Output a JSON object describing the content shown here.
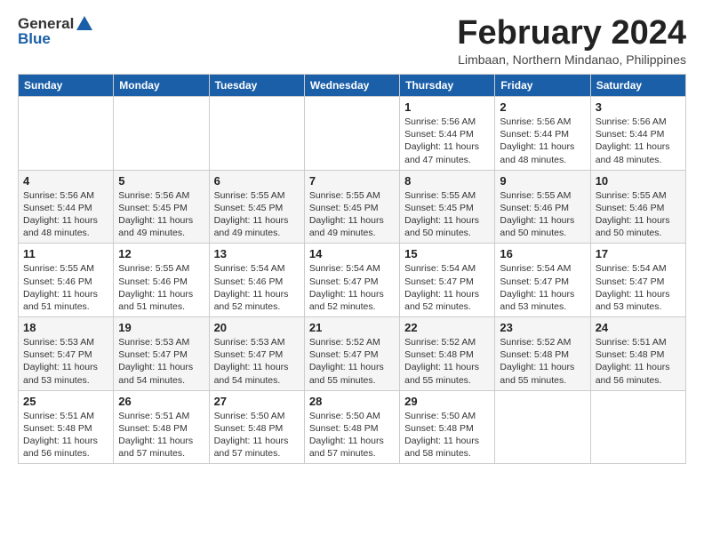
{
  "logo": {
    "text_general": "General",
    "text_blue": "Blue"
  },
  "title": "February 2024",
  "location": "Limbaan, Northern Mindanao, Philippines",
  "days_of_week": [
    "Sunday",
    "Monday",
    "Tuesday",
    "Wednesday",
    "Thursday",
    "Friday",
    "Saturday"
  ],
  "weeks": [
    [
      {
        "day": "",
        "info": ""
      },
      {
        "day": "",
        "info": ""
      },
      {
        "day": "",
        "info": ""
      },
      {
        "day": "",
        "info": ""
      },
      {
        "day": "1",
        "sunrise": "5:56 AM",
        "sunset": "5:44 PM",
        "daylight": "11 hours and 47 minutes."
      },
      {
        "day": "2",
        "sunrise": "5:56 AM",
        "sunset": "5:44 PM",
        "daylight": "11 hours and 48 minutes."
      },
      {
        "day": "3",
        "sunrise": "5:56 AM",
        "sunset": "5:44 PM",
        "daylight": "11 hours and 48 minutes."
      }
    ],
    [
      {
        "day": "4",
        "sunrise": "5:56 AM",
        "sunset": "5:44 PM",
        "daylight": "11 hours and 48 minutes."
      },
      {
        "day": "5",
        "sunrise": "5:56 AM",
        "sunset": "5:45 PM",
        "daylight": "11 hours and 49 minutes."
      },
      {
        "day": "6",
        "sunrise": "5:55 AM",
        "sunset": "5:45 PM",
        "daylight": "11 hours and 49 minutes."
      },
      {
        "day": "7",
        "sunrise": "5:55 AM",
        "sunset": "5:45 PM",
        "daylight": "11 hours and 49 minutes."
      },
      {
        "day": "8",
        "sunrise": "5:55 AM",
        "sunset": "5:45 PM",
        "daylight": "11 hours and 50 minutes."
      },
      {
        "day": "9",
        "sunrise": "5:55 AM",
        "sunset": "5:46 PM",
        "daylight": "11 hours and 50 minutes."
      },
      {
        "day": "10",
        "sunrise": "5:55 AM",
        "sunset": "5:46 PM",
        "daylight": "11 hours and 50 minutes."
      }
    ],
    [
      {
        "day": "11",
        "sunrise": "5:55 AM",
        "sunset": "5:46 PM",
        "daylight": "11 hours and 51 minutes."
      },
      {
        "day": "12",
        "sunrise": "5:55 AM",
        "sunset": "5:46 PM",
        "daylight": "11 hours and 51 minutes."
      },
      {
        "day": "13",
        "sunrise": "5:54 AM",
        "sunset": "5:46 PM",
        "daylight": "11 hours and 52 minutes."
      },
      {
        "day": "14",
        "sunrise": "5:54 AM",
        "sunset": "5:47 PM",
        "daylight": "11 hours and 52 minutes."
      },
      {
        "day": "15",
        "sunrise": "5:54 AM",
        "sunset": "5:47 PM",
        "daylight": "11 hours and 52 minutes."
      },
      {
        "day": "16",
        "sunrise": "5:54 AM",
        "sunset": "5:47 PM",
        "daylight": "11 hours and 53 minutes."
      },
      {
        "day": "17",
        "sunrise": "5:54 AM",
        "sunset": "5:47 PM",
        "daylight": "11 hours and 53 minutes."
      }
    ],
    [
      {
        "day": "18",
        "sunrise": "5:53 AM",
        "sunset": "5:47 PM",
        "daylight": "11 hours and 53 minutes."
      },
      {
        "day": "19",
        "sunrise": "5:53 AM",
        "sunset": "5:47 PM",
        "daylight": "11 hours and 54 minutes."
      },
      {
        "day": "20",
        "sunrise": "5:53 AM",
        "sunset": "5:47 PM",
        "daylight": "11 hours and 54 minutes."
      },
      {
        "day": "21",
        "sunrise": "5:52 AM",
        "sunset": "5:47 PM",
        "daylight": "11 hours and 55 minutes."
      },
      {
        "day": "22",
        "sunrise": "5:52 AM",
        "sunset": "5:48 PM",
        "daylight": "11 hours and 55 minutes."
      },
      {
        "day": "23",
        "sunrise": "5:52 AM",
        "sunset": "5:48 PM",
        "daylight": "11 hours and 55 minutes."
      },
      {
        "day": "24",
        "sunrise": "5:51 AM",
        "sunset": "5:48 PM",
        "daylight": "11 hours and 56 minutes."
      }
    ],
    [
      {
        "day": "25",
        "sunrise": "5:51 AM",
        "sunset": "5:48 PM",
        "daylight": "11 hours and 56 minutes."
      },
      {
        "day": "26",
        "sunrise": "5:51 AM",
        "sunset": "5:48 PM",
        "daylight": "11 hours and 57 minutes."
      },
      {
        "day": "27",
        "sunrise": "5:50 AM",
        "sunset": "5:48 PM",
        "daylight": "11 hours and 57 minutes."
      },
      {
        "day": "28",
        "sunrise": "5:50 AM",
        "sunset": "5:48 PM",
        "daylight": "11 hours and 57 minutes."
      },
      {
        "day": "29",
        "sunrise": "5:50 AM",
        "sunset": "5:48 PM",
        "daylight": "11 hours and 58 minutes."
      },
      {
        "day": "",
        "info": ""
      },
      {
        "day": "",
        "info": ""
      }
    ]
  ]
}
